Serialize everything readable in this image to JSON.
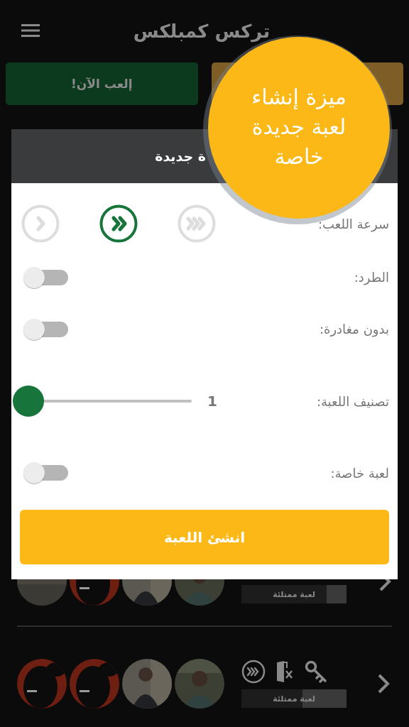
{
  "app_bar": {
    "title": "تركس كمبلكس"
  },
  "tabs": [
    {
      "label": "إلعب الآن!",
      "color": "#0c3a1f"
    },
    {
      "color": "#7e5e26"
    }
  ],
  "dialog": {
    "title": "ة جديدة",
    "rows": [
      {
        "kind": "speed",
        "label": "سرعة اللعب:",
        "options": [
          {
            "kind": "slow",
            "selected": false
          },
          {
            "kind": "normal",
            "selected": true
          },
          {
            "kind": "fast",
            "selected": false
          }
        ]
      },
      {
        "kind": "toggle",
        "label": "الطرد:",
        "on": false
      },
      {
        "kind": "toggle",
        "label": "بدون مغادرة:",
        "on": false
      },
      {
        "kind": "slider",
        "label": "تصنيف اللعبة:",
        "level": 0,
        "reading": "1"
      },
      {
        "kind": "toggle",
        "label": "لعبة خاصة:",
        "on": false
      }
    ],
    "create_button": "انشئ اللعبة"
  },
  "tooltip": {
    "lines": [
      "ميزة إنشاء",
      "لعبة جديدة",
      "خاصة"
    ]
  },
  "games": [
    {
      "avatars": [
        {
          "kind": "picture"
        },
        {
          "kind": "picture"
        },
        {
          "kind": "picture"
        },
        {
          "kind": "picture"
        }
      ],
      "status": "لعبة ممتلئة",
      "level": 0.19
    },
    {
      "avatars": [
        {
          "kind": "picture"
        },
        {
          "kind": "picture"
        },
        {
          "kind": "picture"
        },
        {
          "kind": "picture"
        }
      ],
      "features": [
        {
          "kind": "fast"
        },
        {
          "kind": "no_leave"
        },
        {
          "kind": "private"
        }
      ],
      "status": "لعبة ممتلئة",
      "level": 0.42
    }
  ]
}
